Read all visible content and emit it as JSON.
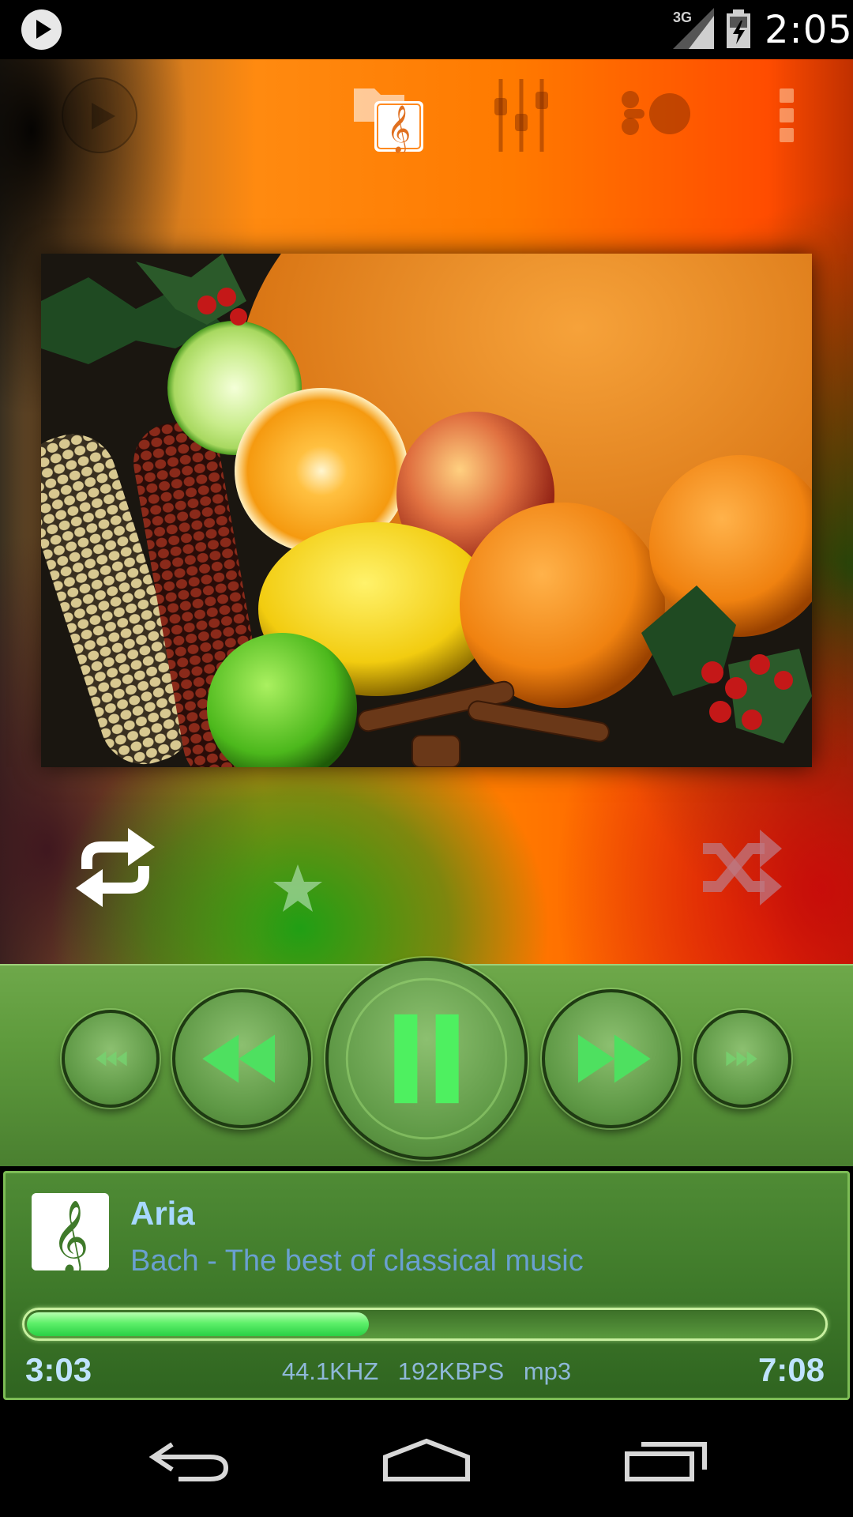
{
  "status_bar": {
    "network_label": "3G",
    "time": "2:05",
    "icons": [
      "play-notification-icon",
      "signal-icon",
      "battery-charging-icon"
    ]
  },
  "toolbar": {
    "icons": [
      "play-icon",
      "music-library-icon",
      "equalizer-icon",
      "visualizer-icon",
      "overflow-menu-icon"
    ]
  },
  "album_art": {
    "icon": "album-art-image"
  },
  "controls": {
    "repeat_icon": "repeat-icon",
    "favorite_icon": "star-icon",
    "shuffle_icon": "shuffle-icon",
    "shuffle_enabled": false
  },
  "transport": {
    "icons": [
      "skip-back-icon",
      "rewind-icon",
      "pause-icon",
      "fast-forward-icon",
      "skip-forward-icon"
    ]
  },
  "track": {
    "title": "Aria",
    "subtitle": "Bach - The best of classical music",
    "elapsed": "3:03",
    "total": "7:08",
    "progress": 0.43,
    "sample_rate": "44.1KHZ",
    "bitrate": "192KBPS",
    "format": "mp3"
  },
  "colors": {
    "accent_green": "#5ef06a",
    "panel_green": "#4f8b35",
    "title_blue": "#a7d8ff"
  },
  "nav_bar": {
    "icons": [
      "back-icon",
      "home-icon",
      "recents-icon"
    ]
  }
}
